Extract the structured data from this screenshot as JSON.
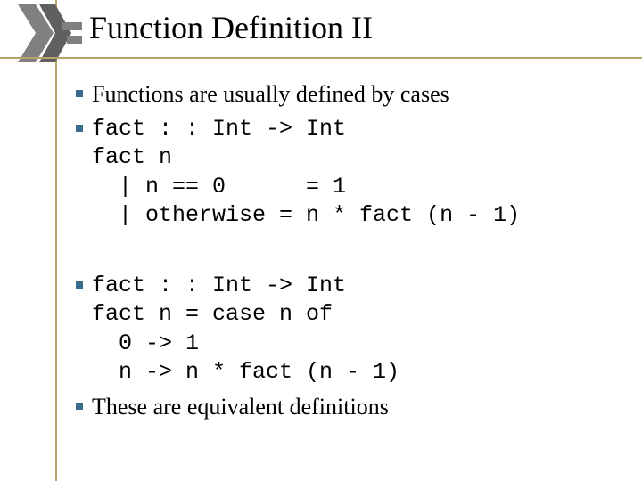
{
  "title": "Function Definition II",
  "bullets": {
    "b1": "Functions are usually defined by cases",
    "b2_code": "fact : : Int -> Int\nfact n\n  | n == 0      = 1\n  | otherwise = n * fact (n - 1)",
    "b3_code": "fact : : Int -> Int\nfact n = case n of\n  0 -> 1\n  n -> n * fact (n - 1)",
    "b4": "These are equivalent definitions"
  }
}
